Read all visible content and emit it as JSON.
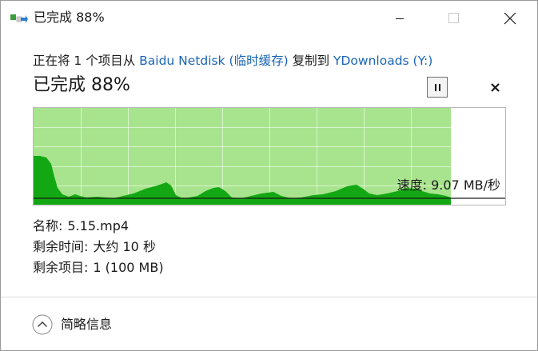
{
  "window": {
    "title": "已完成 88%"
  },
  "header": {
    "prefix": "正在将 1 个项目从",
    "source": "Baidu Netdisk (临时缓存)",
    "middle": "复制到",
    "destination": "YDownloads (Y:)"
  },
  "status": {
    "text": "已完成 88%",
    "percent": 88,
    "speed_label": "速度: 9.07 MB/秒"
  },
  "details": {
    "name_label": "名称:",
    "name_value": "5.15.mp4",
    "time_label": "剩余时间:",
    "time_value": "大约 10 秒",
    "items_label": "剩余项目:",
    "items_value": "1 (100 MB)"
  },
  "footer": {
    "toggle_label": "简略信息"
  },
  "colors": {
    "progress_fill": "#a8e48e",
    "speed_fill": "#13a813",
    "grid": "#c3c3c3",
    "link": "#1a64b4"
  },
  "icons": {
    "app": "copy-transfer-icon",
    "minimize": "minimize-icon",
    "maximize": "maximize-icon",
    "close": "close-icon",
    "pause": "pause-icon",
    "cancel": "cancel-icon",
    "toggle": "chevron-up-icon"
  }
}
